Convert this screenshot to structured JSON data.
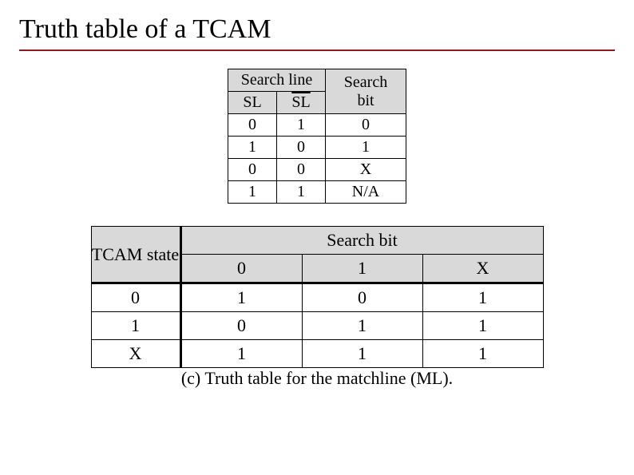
{
  "title": "Truth table of a TCAM",
  "table1": {
    "header": {
      "col12": "Search line",
      "col3": "Search bit",
      "sub1": "SL",
      "sub2": "SL"
    },
    "rows": [
      {
        "sl": "0",
        "slbar": "1",
        "bit": "0"
      },
      {
        "sl": "1",
        "slbar": "0",
        "bit": "1"
      },
      {
        "sl": "0",
        "slbar": "0",
        "bit": "X"
      },
      {
        "sl": "1",
        "slbar": "1",
        "bit": "N/A"
      }
    ]
  },
  "table2": {
    "header": {
      "state": "TCAM state",
      "searchbit": "Search bit",
      "cols": {
        "c0": "0",
        "c1": "1",
        "cx": "X"
      }
    },
    "rows": [
      {
        "state": "0",
        "c0": "1",
        "c1": "0",
        "cx": "1"
      },
      {
        "state": "1",
        "c0": "0",
        "c1": "1",
        "cx": "1"
      },
      {
        "state": "X",
        "c0": "1",
        "c1": "1",
        "cx": "1"
      }
    ]
  },
  "caption": "(c) Truth table for the matchline (ML).",
  "chart_data": [
    {
      "type": "table",
      "title": "Search line to Search bit encoding",
      "columns": [
        "SL",
        "SL_bar",
        "Search bit"
      ],
      "rows": [
        [
          "0",
          "1",
          "0"
        ],
        [
          "1",
          "0",
          "1"
        ],
        [
          "0",
          "0",
          "X"
        ],
        [
          "1",
          "1",
          "N/A"
        ]
      ]
    },
    {
      "type": "table",
      "title": "Truth table for the matchline (ML)",
      "row_header": "TCAM state",
      "col_header": "Search bit",
      "row_labels": [
        "0",
        "1",
        "X"
      ],
      "col_labels": [
        "0",
        "1",
        "X"
      ],
      "values": [
        [
          1,
          0,
          1
        ],
        [
          0,
          1,
          1
        ],
        [
          1,
          1,
          1
        ]
      ]
    }
  ]
}
